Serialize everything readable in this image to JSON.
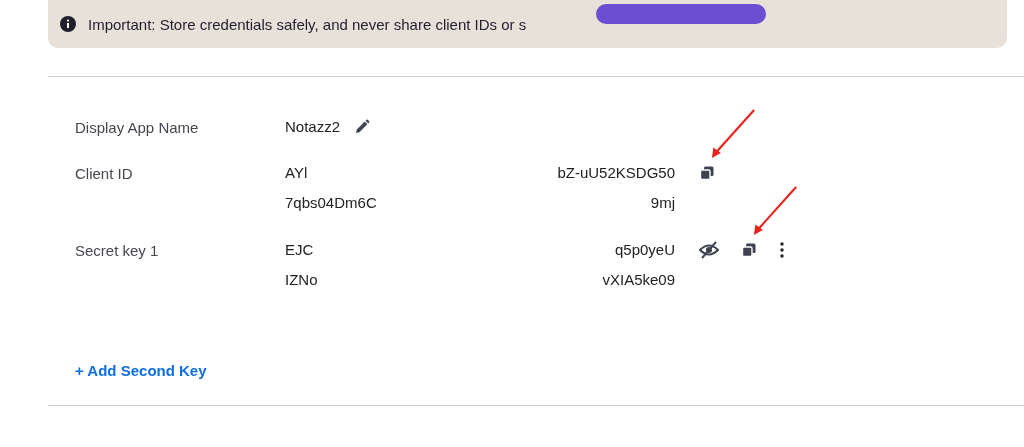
{
  "notice": {
    "text": "Important: Store credentials safely, and never share client IDs or s"
  },
  "fields": [
    {
      "label": "Display App Name",
      "kind": "name",
      "lines": [
        [
          "Notazz2"
        ]
      ],
      "actions": [
        {
          "kind": "edit",
          "annotated": false
        }
      ]
    },
    {
      "label": "Client ID",
      "kind": "secret",
      "lines": [
        [
          "AYl",
          "bZ-uU52KSDG50"
        ],
        [
          "7qbs04Dm6C",
          "9mj"
        ]
      ],
      "actions": [
        {
          "kind": "copy",
          "annotated": true
        }
      ]
    },
    {
      "label": "Secret key 1",
      "kind": "secret",
      "lines": [
        [
          "EJC",
          "q5p0yeU"
        ],
        [
          "IZNo",
          "vXIA5ke09"
        ]
      ],
      "actions": [
        {
          "kind": "hide",
          "annotated": false
        },
        {
          "kind": "copy",
          "annotated": true
        },
        {
          "kind": "more",
          "annotated": false
        }
      ]
    }
  ],
  "add_link": "+ Add Second Key"
}
